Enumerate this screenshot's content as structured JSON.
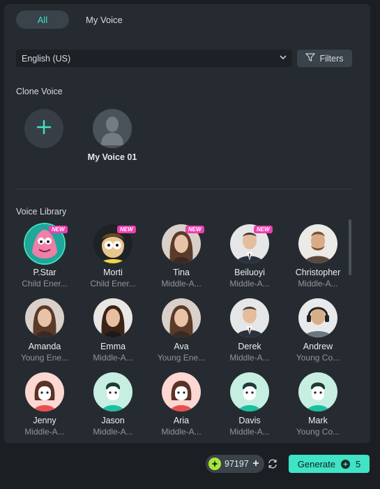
{
  "tabs": [
    {
      "label": "All",
      "active": true
    },
    {
      "label": "My Voice",
      "active": false
    }
  ],
  "language": {
    "selected": "English (US)"
  },
  "filters": {
    "label": "Filters",
    "icon": "filter-icon"
  },
  "clone_section": {
    "title": "Clone Voice",
    "add_icon": "plus-icon",
    "items": [
      {
        "name": "My Voice 01"
      }
    ]
  },
  "library": {
    "title": "Voice Library",
    "voices": [
      {
        "name": "P.Star",
        "desc": "Child Ener...",
        "new": true,
        "selected": true,
        "avatar": "cartoon-starfish"
      },
      {
        "name": "Morti",
        "desc": "Child Ener...",
        "new": true,
        "selected": false,
        "avatar": "cartoon-boy"
      },
      {
        "name": "Tina",
        "desc": "Middle-A...",
        "new": true,
        "selected": false,
        "avatar": "photo-woman"
      },
      {
        "name": "Beiluoyi",
        "desc": "Middle-A...",
        "new": true,
        "selected": false,
        "avatar": "photo-man-suit"
      },
      {
        "name": "Christopher",
        "desc": "Middle-A...",
        "new": false,
        "selected": false,
        "avatar": "photo-man-beard"
      },
      {
        "name": "Amanda",
        "desc": "Young Ene...",
        "new": false,
        "selected": false,
        "avatar": "photo-woman"
      },
      {
        "name": "Emma",
        "desc": "Middle-A...",
        "new": false,
        "selected": false,
        "avatar": "photo-woman-dark"
      },
      {
        "name": "Ava",
        "desc": "Young Ene...",
        "new": false,
        "selected": false,
        "avatar": "photo-woman"
      },
      {
        "name": "Derek",
        "desc": "Middle-A...",
        "new": false,
        "selected": false,
        "avatar": "photo-man-suit"
      },
      {
        "name": "Andrew",
        "desc": "Young Co...",
        "new": false,
        "selected": false,
        "avatar": "photo-man-headphones"
      },
      {
        "name": "Jenny",
        "desc": "Middle-A...",
        "new": false,
        "selected": false,
        "avatar": "illustration-girl"
      },
      {
        "name": "Jason",
        "desc": "Middle-A...",
        "new": false,
        "selected": false,
        "avatar": "illustration-boy"
      },
      {
        "name": "Aria",
        "desc": "Middle-A...",
        "new": false,
        "selected": false,
        "avatar": "illustration-girl"
      },
      {
        "name": "Davis",
        "desc": "Middle-A...",
        "new": false,
        "selected": false,
        "avatar": "illustration-boy"
      },
      {
        "name": "Mark",
        "desc": "Young Co...",
        "new": false,
        "selected": false,
        "avatar": "illustration-boy"
      }
    ],
    "new_badge": "NEW"
  },
  "footer": {
    "credits": "97197",
    "generate_label": "Generate",
    "generate_cost": "5"
  },
  "colors": {
    "accent": "#3fe3c5",
    "new_badge": "#ef3fb0",
    "panel": "#262b31"
  }
}
